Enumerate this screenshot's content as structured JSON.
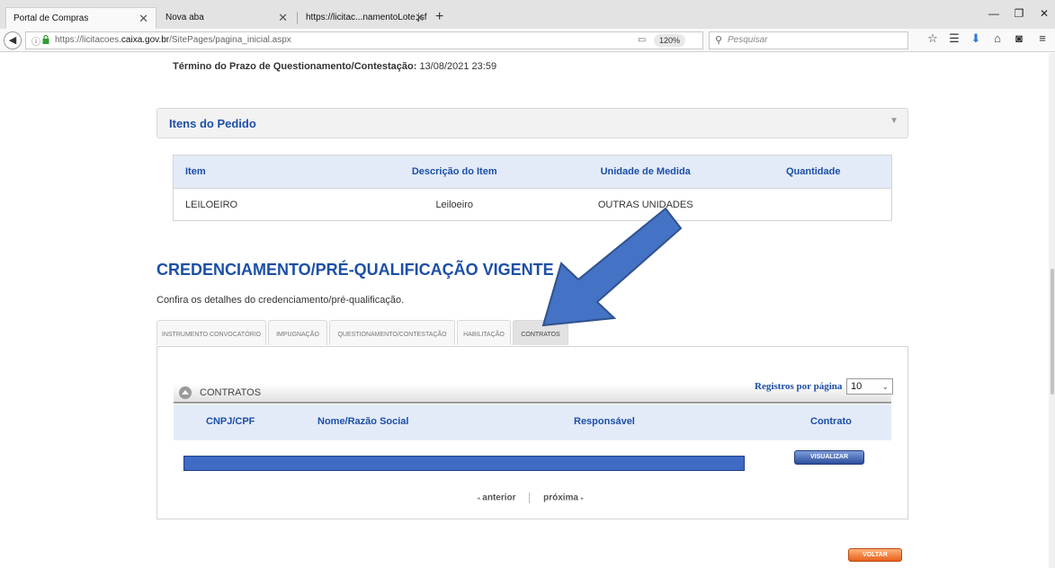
{
  "browser": {
    "tabs": [
      {
        "title": "Portal de Compras",
        "close": "✕"
      },
      {
        "title": "Nova aba",
        "close": "✕"
      },
      {
        "title": "https://licitac...namentoLote.jsf",
        "close": "✕"
      }
    ],
    "new_tab": "+",
    "window_controls": {
      "minimize": "—",
      "restore": "❐",
      "close": "✕"
    },
    "url_prefix": "https://licitacoes.",
    "url_domain": "caixa.gov.br",
    "url_path": "/SitePages/pagina_inicial.aspx",
    "zoom": "120%",
    "search_placeholder": "Pesquisar"
  },
  "page": {
    "deadline_label": "Término do Prazo de Questionamento/Contestação:",
    "deadline_value": "13/08/2021 23:59",
    "itens_title": "Itens do Pedido",
    "items_table": {
      "headers": [
        "Item",
        "Descrição do Item",
        "Unidade de Medida",
        "Quantidade"
      ],
      "rows": [
        [
          "LEILOEIRO",
          "Leiloeiro",
          "OUTRAS UNIDADES",
          ""
        ]
      ]
    },
    "section_title": "CREDENCIAMENTO/PRÉ-QUALIFICAÇÃO VIGENTE",
    "section_subtitle": "Confira os detalhes do credenciamento/pré-qualificação.",
    "tabs": [
      "INSTRUMENTO CONVOCATÓRIO",
      "IMPUGNAÇÃO",
      "QUESTIONAMENTO/CONTESTAÇÃO",
      "HABILITAÇÃO",
      "CONTRATOS"
    ],
    "active_tab": "CONTRATOS",
    "contracts": {
      "title": "CONTRATOS",
      "per_page_label": "Registros por página",
      "per_page_value": "10",
      "headers": [
        "CNPJ/CPF",
        "Nome/Razão Social",
        "Responsável",
        "Contrato"
      ],
      "view_button": "VISUALIZAR"
    },
    "pager": {
      "prev": "anterior",
      "next": "próxima"
    },
    "back_button": "VOLTAR"
  },
  "colors": {
    "brand_blue": "#1c4fa8",
    "header_bg": "#e3ebf9",
    "annotation_arrow": "#4472c4",
    "voltar_orange": "#e8601c"
  }
}
